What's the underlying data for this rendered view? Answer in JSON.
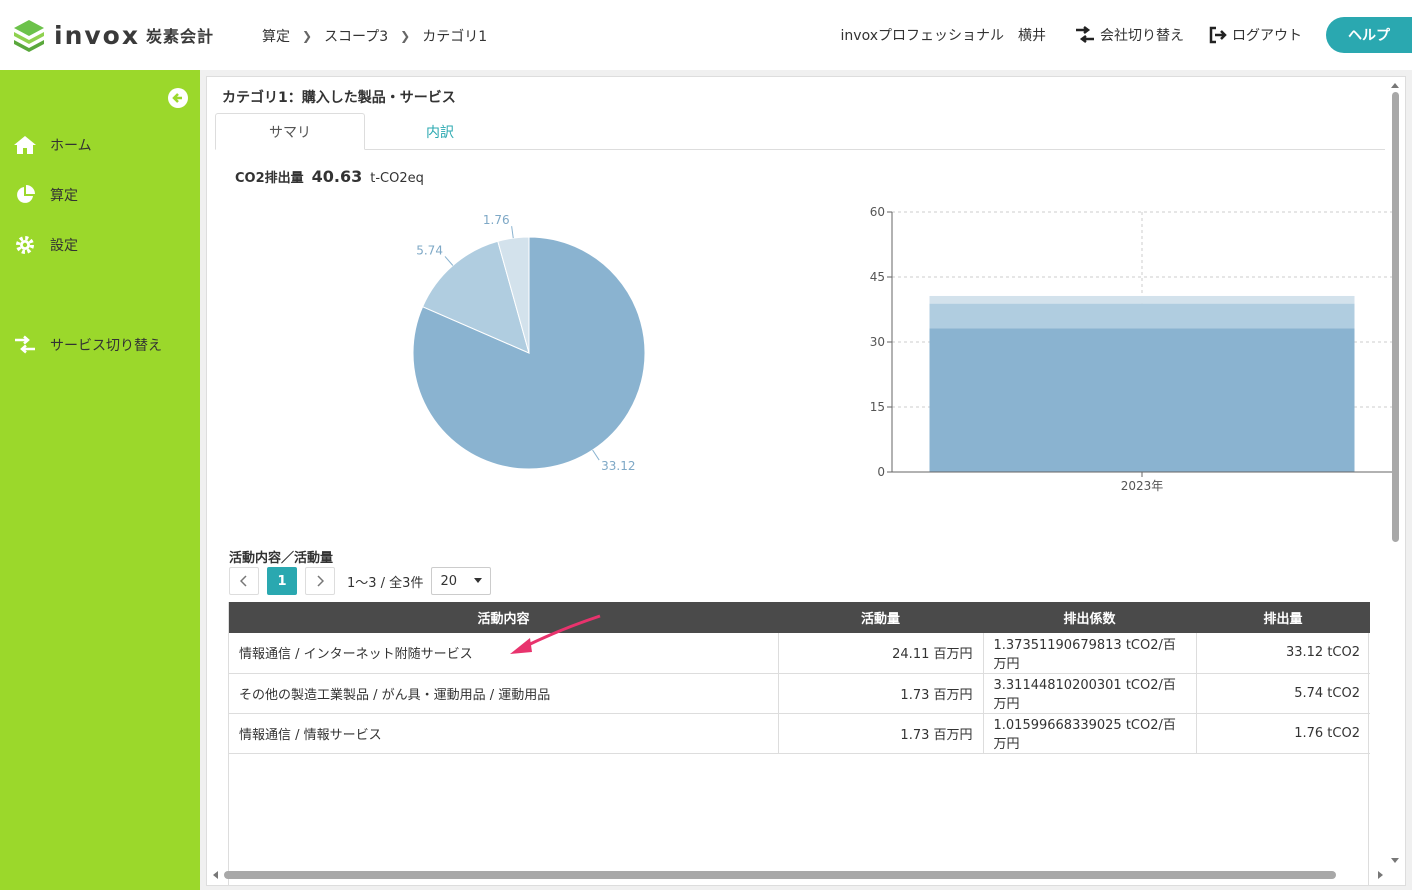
{
  "brand": {
    "name": "invox",
    "sub": "炭素会計"
  },
  "breadcrumb": [
    "算定",
    "スコープ3",
    "カテゴリ1"
  ],
  "header": {
    "user": "invoxプロフェッショナル　横井",
    "switch_company": "会社切り替え",
    "logout": "ログアウト",
    "help": "ヘルプ"
  },
  "sidebar": {
    "items": [
      {
        "label": "ホーム",
        "icon": "home-icon"
      },
      {
        "label": "算定",
        "icon": "pie-chart-icon"
      },
      {
        "label": "設定",
        "icon": "gear-icon"
      },
      {
        "label": "サービス切り替え",
        "icon": "switch-icon"
      }
    ]
  },
  "page": {
    "title": "カテゴリ1：購入した製品・サービス",
    "tabs": [
      "サマリ",
      "内訳"
    ],
    "active_tab": 0,
    "total_label": "CO2排出量",
    "total_value": "40.63",
    "total_unit": "t-CO2eq"
  },
  "chart_data": [
    {
      "type": "pie",
      "values": [
        33.12,
        5.74,
        1.76
      ],
      "labels": [
        "33.12",
        "5.74",
        "1.76"
      ],
      "colors": [
        "#8ab3d0",
        "#b0cde0",
        "#d3e2ec"
      ]
    },
    {
      "type": "bar",
      "stacked": true,
      "categories": [
        "2023年"
      ],
      "series": [
        {
          "values": [
            33.12
          ],
          "color": "#8ab3d0"
        },
        {
          "values": [
            5.74
          ],
          "color": "#b0cde0"
        },
        {
          "values": [
            1.76
          ],
          "color": "#d3e2ec"
        }
      ],
      "ylim": [
        0,
        60
      ],
      "yticks": [
        0,
        15,
        30,
        45,
        60
      ],
      "grid": true
    }
  ],
  "activity": {
    "title": "活動内容／活動量",
    "current_page": "1",
    "range_text": "1〜3 / 全3件",
    "page_size": "20",
    "columns": [
      "活動内容",
      "活動量",
      "排出係数",
      "排出量"
    ],
    "rows": [
      [
        "情報通信 / インターネット附随サービス",
        "24.11 百万円",
        "1.37351190679813 tCO2/百万円",
        "33.12 tCO2"
      ],
      [
        "その他の製造工業製品 / がん具・運動用品 / 運動用品",
        "1.73 百万円",
        "3.31144810200301 tCO2/百万円",
        "5.74 tCO2"
      ],
      [
        "情報通信 / 情報サービス",
        "1.73 百万円",
        "1.01599668339025 tCO2/百万円",
        "1.76 tCO2"
      ]
    ]
  },
  "colors": {
    "accent": "#2aa8b0",
    "sidebar": "#9bd82b",
    "table_header": "#4a4a4a",
    "arrow": "#e8336d"
  }
}
